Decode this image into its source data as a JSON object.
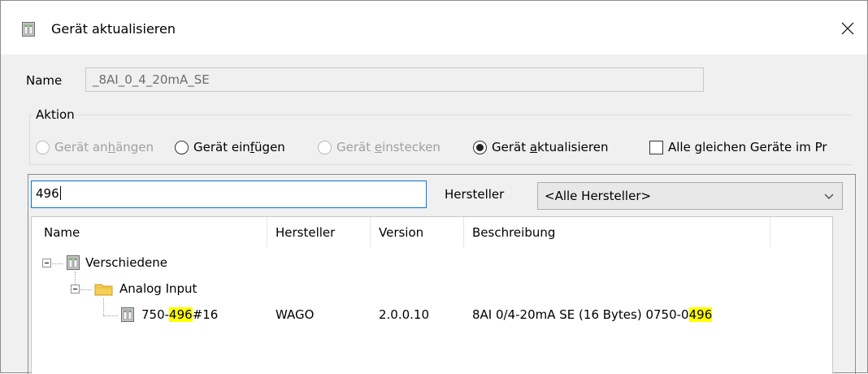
{
  "window": {
    "title": "Gerät aktualisieren",
    "close_glyph": "✕"
  },
  "name": {
    "label": "Name",
    "value": "_8AI_0_4_20mA_SE"
  },
  "action": {
    "legend": "Aktion",
    "options": [
      {
        "pre": "Gerät an",
        "acc": "h",
        "post": "ängen",
        "type": "radio",
        "checked": false,
        "enabled": false
      },
      {
        "pre": "Gerät ein",
        "acc": "f",
        "post": "ügen",
        "type": "radio",
        "checked": false,
        "enabled": true
      },
      {
        "pre": "Gerät ",
        "acc": "e",
        "post": "instecken",
        "type": "radio",
        "checked": false,
        "enabled": false
      },
      {
        "pre": "Gerät ",
        "acc": "a",
        "post": "ktualisieren",
        "type": "radio",
        "checked": true,
        "enabled": true
      }
    ],
    "checkbox_label": "Alle gleichen Geräte im Pr",
    "checkbox_checked": false
  },
  "search": {
    "value": "496"
  },
  "vendor": {
    "label": "Hersteller",
    "selected": "<Alle Hersteller>"
  },
  "table": {
    "columns": [
      "Name",
      "Hersteller",
      "Version",
      "Beschreibung"
    ],
    "tree": {
      "root": {
        "label": "Verschiedene",
        "icon": "device-icon",
        "expanded": true
      },
      "folder": {
        "label": "Analog Input",
        "icon": "folder-icon",
        "expanded": true
      },
      "device": {
        "name_pre": "750-",
        "name_match": "496",
        "name_post": "#16",
        "vendor": "WAGO",
        "version": "2.0.0.10",
        "desc_pre": "8AI 0/4-20mA SE (16 Bytes)  0750-0",
        "desc_match": "496",
        "icon": "device-icon"
      }
    }
  },
  "colors": {
    "highlight": "#ffff00",
    "focus_border": "#0078d7",
    "disabled_text": "#a0a0a0"
  }
}
